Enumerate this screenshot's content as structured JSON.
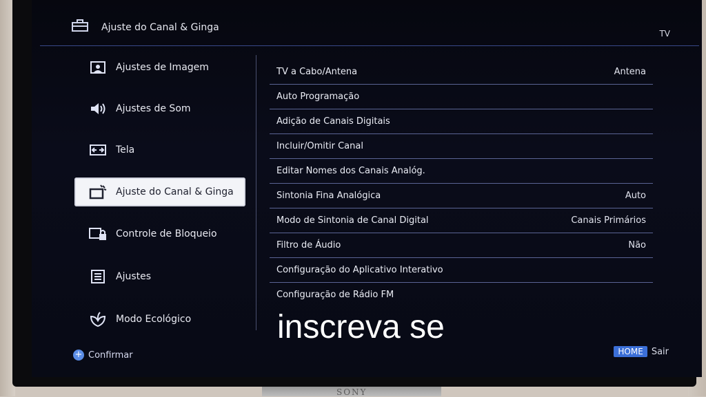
{
  "header": {
    "icon": "toolbox-icon",
    "title": "Ajuste do Canal & Ginga",
    "input_source": "TV"
  },
  "sidebar": {
    "items": [
      {
        "label": "Ajustes de Imagem",
        "icon": "picture-icon",
        "selected": false
      },
      {
        "label": "Ajustes de Som",
        "icon": "speaker-icon",
        "selected": false
      },
      {
        "label": "Tela",
        "icon": "screen-icon",
        "selected": false
      },
      {
        "label": "Ajuste do Canal & Ginga",
        "icon": "channel-icon",
        "selected": true
      },
      {
        "label": "Controle de Bloqueio",
        "icon": "lock-icon",
        "selected": false
      },
      {
        "label": "Ajustes",
        "icon": "settings-list-icon",
        "selected": false
      },
      {
        "label": "Modo Ecológico",
        "icon": "leaf-icon",
        "selected": false
      }
    ]
  },
  "menu": {
    "rows": [
      {
        "label": "TV a Cabo/Antena",
        "value": "Antena"
      },
      {
        "label": "Auto Programação",
        "value": ""
      },
      {
        "label": "Adição de Canais Digitais",
        "value": ""
      },
      {
        "label": "Incluir/Omitir Canal",
        "value": ""
      },
      {
        "label": "Editar Nomes dos Canais Analóg.",
        "value": ""
      },
      {
        "label": "Sintonia Fina Analógica",
        "value": "Auto"
      },
      {
        "label": "Modo de Sintonia de Canal Digital",
        "value": "Canais Primários"
      },
      {
        "label": "Filtro de Áudio",
        "value": "Não"
      },
      {
        "label": "Configuração do Aplicativo Interativo",
        "value": ""
      },
      {
        "label": "Configuração de Rádio FM",
        "value": ""
      }
    ]
  },
  "footer": {
    "confirm_label": "Confirmar",
    "home_button": "HOME",
    "exit_label": "Sair"
  },
  "overlay": {
    "caption": "inscreva se"
  },
  "brand": "SONY",
  "colors": {
    "screen_bg": "#080a15",
    "accent_blue": "#3b6fd8",
    "divider": "#5a6494",
    "selected_bg": "#f3f4f8"
  }
}
